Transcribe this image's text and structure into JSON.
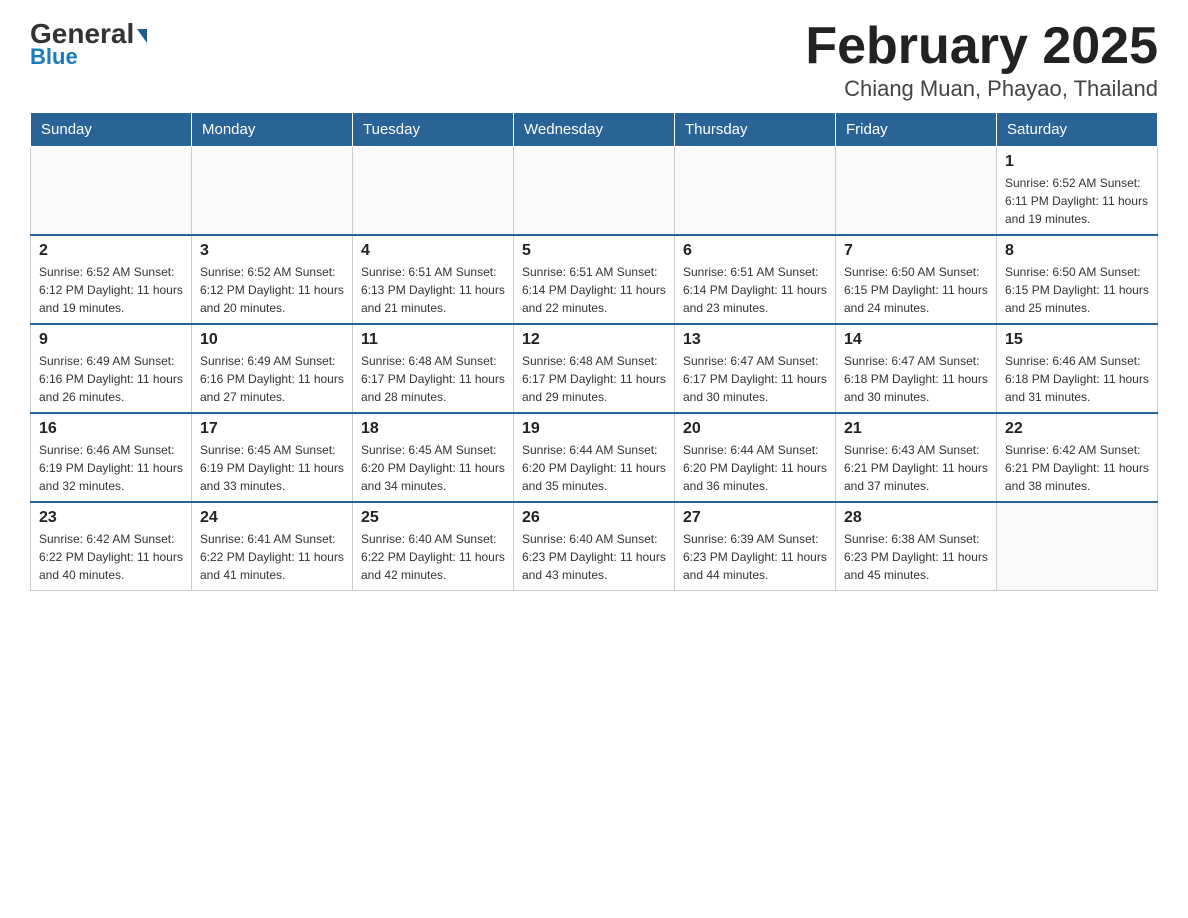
{
  "header": {
    "logo_general": "General",
    "logo_blue": "Blue",
    "month_title": "February 2025",
    "location": "Chiang Muan, Phayao, Thailand"
  },
  "days_of_week": [
    "Sunday",
    "Monday",
    "Tuesday",
    "Wednesday",
    "Thursday",
    "Friday",
    "Saturday"
  ],
  "weeks": [
    [
      {
        "day": "",
        "info": ""
      },
      {
        "day": "",
        "info": ""
      },
      {
        "day": "",
        "info": ""
      },
      {
        "day": "",
        "info": ""
      },
      {
        "day": "",
        "info": ""
      },
      {
        "day": "",
        "info": ""
      },
      {
        "day": "1",
        "info": "Sunrise: 6:52 AM\nSunset: 6:11 PM\nDaylight: 11 hours and 19 minutes."
      }
    ],
    [
      {
        "day": "2",
        "info": "Sunrise: 6:52 AM\nSunset: 6:12 PM\nDaylight: 11 hours and 19 minutes."
      },
      {
        "day": "3",
        "info": "Sunrise: 6:52 AM\nSunset: 6:12 PM\nDaylight: 11 hours and 20 minutes."
      },
      {
        "day": "4",
        "info": "Sunrise: 6:51 AM\nSunset: 6:13 PM\nDaylight: 11 hours and 21 minutes."
      },
      {
        "day": "5",
        "info": "Sunrise: 6:51 AM\nSunset: 6:14 PM\nDaylight: 11 hours and 22 minutes."
      },
      {
        "day": "6",
        "info": "Sunrise: 6:51 AM\nSunset: 6:14 PM\nDaylight: 11 hours and 23 minutes."
      },
      {
        "day": "7",
        "info": "Sunrise: 6:50 AM\nSunset: 6:15 PM\nDaylight: 11 hours and 24 minutes."
      },
      {
        "day": "8",
        "info": "Sunrise: 6:50 AM\nSunset: 6:15 PM\nDaylight: 11 hours and 25 minutes."
      }
    ],
    [
      {
        "day": "9",
        "info": "Sunrise: 6:49 AM\nSunset: 6:16 PM\nDaylight: 11 hours and 26 minutes."
      },
      {
        "day": "10",
        "info": "Sunrise: 6:49 AM\nSunset: 6:16 PM\nDaylight: 11 hours and 27 minutes."
      },
      {
        "day": "11",
        "info": "Sunrise: 6:48 AM\nSunset: 6:17 PM\nDaylight: 11 hours and 28 minutes."
      },
      {
        "day": "12",
        "info": "Sunrise: 6:48 AM\nSunset: 6:17 PM\nDaylight: 11 hours and 29 minutes."
      },
      {
        "day": "13",
        "info": "Sunrise: 6:47 AM\nSunset: 6:17 PM\nDaylight: 11 hours and 30 minutes."
      },
      {
        "day": "14",
        "info": "Sunrise: 6:47 AM\nSunset: 6:18 PM\nDaylight: 11 hours and 30 minutes."
      },
      {
        "day": "15",
        "info": "Sunrise: 6:46 AM\nSunset: 6:18 PM\nDaylight: 11 hours and 31 minutes."
      }
    ],
    [
      {
        "day": "16",
        "info": "Sunrise: 6:46 AM\nSunset: 6:19 PM\nDaylight: 11 hours and 32 minutes."
      },
      {
        "day": "17",
        "info": "Sunrise: 6:45 AM\nSunset: 6:19 PM\nDaylight: 11 hours and 33 minutes."
      },
      {
        "day": "18",
        "info": "Sunrise: 6:45 AM\nSunset: 6:20 PM\nDaylight: 11 hours and 34 minutes."
      },
      {
        "day": "19",
        "info": "Sunrise: 6:44 AM\nSunset: 6:20 PM\nDaylight: 11 hours and 35 minutes."
      },
      {
        "day": "20",
        "info": "Sunrise: 6:44 AM\nSunset: 6:20 PM\nDaylight: 11 hours and 36 minutes."
      },
      {
        "day": "21",
        "info": "Sunrise: 6:43 AM\nSunset: 6:21 PM\nDaylight: 11 hours and 37 minutes."
      },
      {
        "day": "22",
        "info": "Sunrise: 6:42 AM\nSunset: 6:21 PM\nDaylight: 11 hours and 38 minutes."
      }
    ],
    [
      {
        "day": "23",
        "info": "Sunrise: 6:42 AM\nSunset: 6:22 PM\nDaylight: 11 hours and 40 minutes."
      },
      {
        "day": "24",
        "info": "Sunrise: 6:41 AM\nSunset: 6:22 PM\nDaylight: 11 hours and 41 minutes."
      },
      {
        "day": "25",
        "info": "Sunrise: 6:40 AM\nSunset: 6:22 PM\nDaylight: 11 hours and 42 minutes."
      },
      {
        "day": "26",
        "info": "Sunrise: 6:40 AM\nSunset: 6:23 PM\nDaylight: 11 hours and 43 minutes."
      },
      {
        "day": "27",
        "info": "Sunrise: 6:39 AM\nSunset: 6:23 PM\nDaylight: 11 hours and 44 minutes."
      },
      {
        "day": "28",
        "info": "Sunrise: 6:38 AM\nSunset: 6:23 PM\nDaylight: 11 hours and 45 minutes."
      },
      {
        "day": "",
        "info": ""
      }
    ]
  ]
}
